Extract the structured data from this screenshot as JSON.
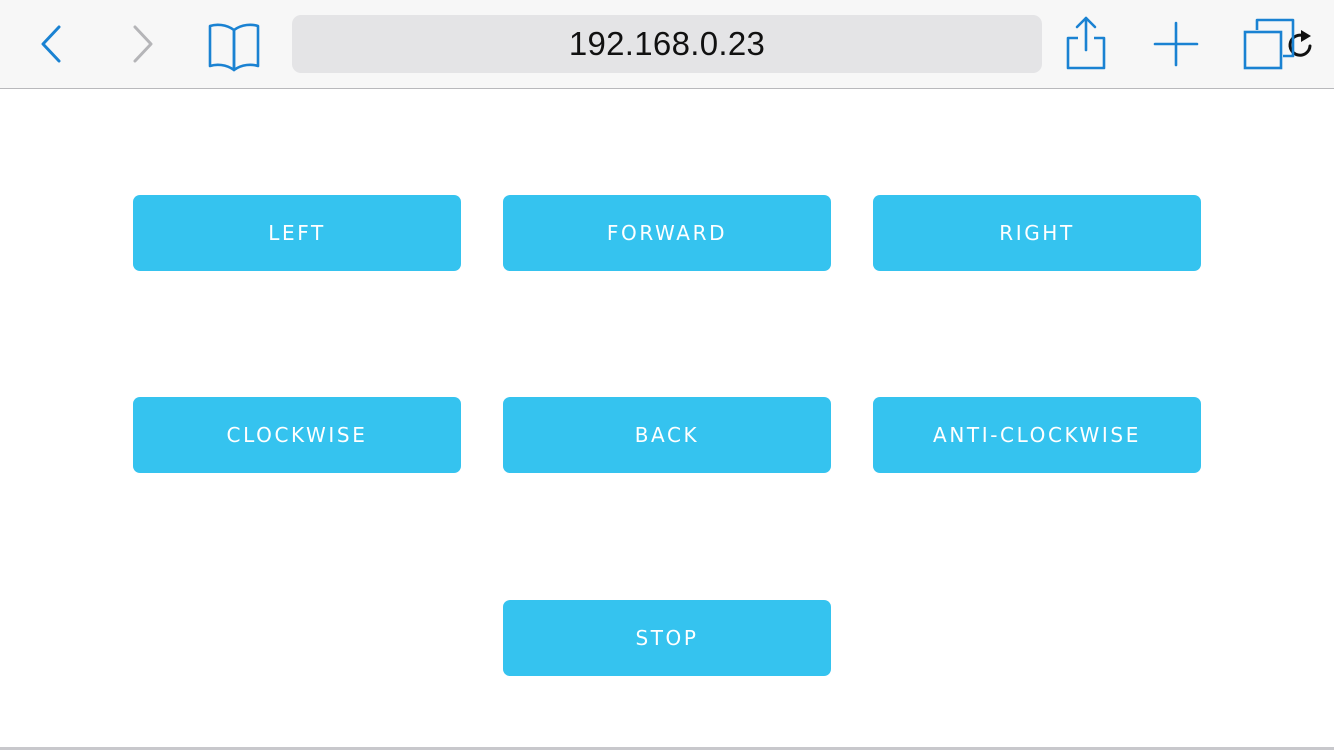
{
  "browser": {
    "address": "192.168.0.23",
    "icons": {
      "back": "chevron-left-icon",
      "forward": "chevron-right-icon",
      "bookmarks": "book-icon",
      "reload": "reload-icon",
      "share": "share-icon",
      "new_tab": "plus-icon",
      "tabs": "tabs-icon"
    },
    "colors": {
      "accent": "#1a82d2",
      "disabled": "#b5b5b8",
      "toolbar_bg": "#f7f7f7",
      "address_bg": "#e4e4e6"
    }
  },
  "controls": {
    "left": "LEFT",
    "forward": "FORWARD",
    "right": "RIGHT",
    "clockwise": "CLOCKWISE",
    "back": "BACK",
    "anti_clockwise": "ANTI-CLOCKWISE",
    "stop": "STOP",
    "button_color": "#35c3ef",
    "text_color": "#ffffff"
  }
}
